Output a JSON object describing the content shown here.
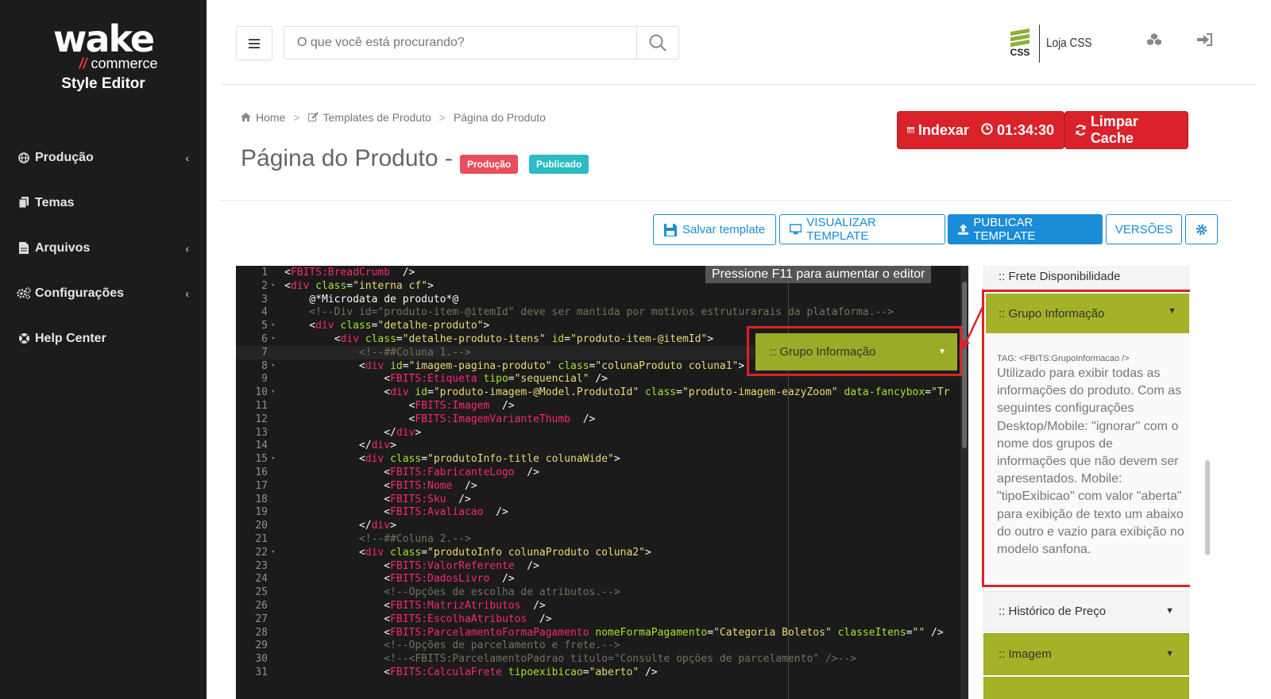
{
  "sidebar": {
    "logo_wake": "wake",
    "logo_commerce": "commerce",
    "logo_title": "Style Editor",
    "items": [
      {
        "label": "Produção",
        "icon": "globe-icon",
        "has_chevron": true
      },
      {
        "label": "Temas",
        "icon": "files-icon",
        "has_chevron": false
      },
      {
        "label": "Arquivos",
        "icon": "file-icon",
        "has_chevron": true
      },
      {
        "label": "Configurações",
        "icon": "cogs-icon",
        "has_chevron": true
      },
      {
        "label": "Help Center",
        "icon": "lifebuoy-icon",
        "has_chevron": false
      }
    ]
  },
  "topbar": {
    "search_placeholder": "O que você está procurando?",
    "brand_mark": "CSS",
    "brand_name": "Loja CSS"
  },
  "breadcrumb": {
    "home": "Home",
    "templates": "Templates de Produto",
    "current": "Página do Produto"
  },
  "page": {
    "title": "Página do Produto -",
    "badge_env": "Produção",
    "badge_status": "Publicado"
  },
  "actions": {
    "index_label": "Indexar",
    "index_timer": "01:34:30",
    "clear_cache": "Limpar Cache",
    "save_template": "Salvar template",
    "view_template": "VISUALIZAR TEMPLATE",
    "publish_template": "PUBLICAR TEMPLATE",
    "versions": "VERSÕES"
  },
  "editor": {
    "hint": "Pressione F11 para aumentar o editor",
    "active_line": 7,
    "lines": [
      {
        "n": 1,
        "fold": false
      },
      {
        "n": 2,
        "fold": true
      },
      {
        "n": 3,
        "fold": false
      },
      {
        "n": 4,
        "fold": false
      },
      {
        "n": 5,
        "fold": true
      },
      {
        "n": 6,
        "fold": true
      },
      {
        "n": 7,
        "fold": false
      },
      {
        "n": 8,
        "fold": true
      },
      {
        "n": 9,
        "fold": false
      },
      {
        "n": 10,
        "fold": true
      },
      {
        "n": 11,
        "fold": false
      },
      {
        "n": 12,
        "fold": false
      },
      {
        "n": 13,
        "fold": false
      },
      {
        "n": 14,
        "fold": false
      },
      {
        "n": 15,
        "fold": true
      },
      {
        "n": 16,
        "fold": false
      },
      {
        "n": 17,
        "fold": false
      },
      {
        "n": 18,
        "fold": false
      },
      {
        "n": 19,
        "fold": false
      },
      {
        "n": 20,
        "fold": false
      },
      {
        "n": 21,
        "fold": false
      },
      {
        "n": 22,
        "fold": true
      },
      {
        "n": 23,
        "fold": false
      },
      {
        "n": 24,
        "fold": false
      },
      {
        "n": 25,
        "fold": false
      },
      {
        "n": 26,
        "fold": false
      },
      {
        "n": 27,
        "fold": false
      },
      {
        "n": 28,
        "fold": false
      },
      {
        "n": 29,
        "fold": false
      },
      {
        "n": 30,
        "fold": false
      },
      {
        "n": 31,
        "fold": false
      }
    ],
    "code": [
      [
        [
          "t",
          "<"
        ],
        [
          "p",
          "FBITS:BreadCrumb"
        ],
        [
          "t",
          "  />"
        ]
      ],
      [
        [
          "t",
          "<"
        ],
        [
          "p",
          "div"
        ],
        [
          "t",
          " "
        ],
        [
          "a",
          "class"
        ],
        [
          "t",
          "="
        ],
        [
          "s",
          "\"interna cf\""
        ],
        [
          "t",
          ">"
        ]
      ],
      [
        [
          "t",
          "    @*Microdata de produto*@"
        ]
      ],
      [
        [
          "c",
          "    <!--Div id=\"produto-item-@itemId\" deve ser mantida por motivos estruturarais da plataforma.-->"
        ]
      ],
      [
        [
          "t",
          "    <"
        ],
        [
          "p",
          "div"
        ],
        [
          "t",
          " "
        ],
        [
          "a",
          "class"
        ],
        [
          "t",
          "="
        ],
        [
          "s",
          "\"detalhe-produto\""
        ],
        [
          "t",
          ">"
        ]
      ],
      [
        [
          "t",
          "        <"
        ],
        [
          "p",
          "div"
        ],
        [
          "t",
          " "
        ],
        [
          "a",
          "class"
        ],
        [
          "t",
          "="
        ],
        [
          "s",
          "\"detalhe-produto-itens\""
        ],
        [
          "t",
          " "
        ],
        [
          "a",
          "id"
        ],
        [
          "t",
          "="
        ],
        [
          "s",
          "\"produto-item-@itemId\""
        ],
        [
          "t",
          ">"
        ]
      ],
      [
        [
          "c",
          "            <!--##Coluna 1.-->"
        ]
      ],
      [
        [
          "t",
          "            <"
        ],
        [
          "p",
          "div"
        ],
        [
          "t",
          " "
        ],
        [
          "a",
          "id"
        ],
        [
          "t",
          "="
        ],
        [
          "s",
          "\"imagem-pagina-produto\""
        ],
        [
          "t",
          " "
        ],
        [
          "a",
          "class"
        ],
        [
          "t",
          "="
        ],
        [
          "s",
          "\"colunaProduto coluna1\""
        ],
        [
          "t",
          ">"
        ]
      ],
      [
        [
          "t",
          "                <"
        ],
        [
          "p",
          "FBITS:Etiqueta"
        ],
        [
          "t",
          " "
        ],
        [
          "a",
          "tipo"
        ],
        [
          "t",
          "="
        ],
        [
          "s",
          "\"sequencial\""
        ],
        [
          "t",
          " />"
        ]
      ],
      [
        [
          "t",
          "                <"
        ],
        [
          "p",
          "div"
        ],
        [
          "t",
          " "
        ],
        [
          "a",
          "id"
        ],
        [
          "t",
          "="
        ],
        [
          "s",
          "\"produto-imagem-@Model.ProdutoId\""
        ],
        [
          "t",
          " "
        ],
        [
          "a",
          "class"
        ],
        [
          "t",
          "="
        ],
        [
          "s",
          "\"produto-imagem-eazyZoom\""
        ],
        [
          "t",
          " "
        ],
        [
          "a",
          "data-fancybox"
        ],
        [
          "t",
          "="
        ],
        [
          "s",
          "\"Tr"
        ]
      ],
      [
        [
          "t",
          "                    <"
        ],
        [
          "p",
          "FBITS:Imagem"
        ],
        [
          "t",
          "  />"
        ]
      ],
      [
        [
          "t",
          "                    <"
        ],
        [
          "p",
          "FBITS:ImagemVarianteThumb"
        ],
        [
          "t",
          "  />"
        ]
      ],
      [
        [
          "t",
          "                </"
        ],
        [
          "p",
          "div"
        ],
        [
          "t",
          ">"
        ]
      ],
      [
        [
          "t",
          "            </"
        ],
        [
          "p",
          "div"
        ],
        [
          "t",
          ">"
        ]
      ],
      [
        [
          "t",
          "            <"
        ],
        [
          "p",
          "div"
        ],
        [
          "t",
          " "
        ],
        [
          "a",
          "class"
        ],
        [
          "t",
          "="
        ],
        [
          "s",
          "\"produtoInfo-title colunaWide\""
        ],
        [
          "t",
          ">"
        ]
      ],
      [
        [
          "t",
          "                <"
        ],
        [
          "p",
          "FBITS:FabricanteLogo"
        ],
        [
          "t",
          "  />"
        ]
      ],
      [
        [
          "t",
          "                <"
        ],
        [
          "p",
          "FBITS:Nome"
        ],
        [
          "t",
          "  />"
        ]
      ],
      [
        [
          "t",
          "                <"
        ],
        [
          "p",
          "FBITS:Sku"
        ],
        [
          "t",
          "  />"
        ]
      ],
      [
        [
          "t",
          "                <"
        ],
        [
          "p",
          "FBITS:Avaliacao"
        ],
        [
          "t",
          "  />"
        ]
      ],
      [
        [
          "t",
          "            </"
        ],
        [
          "p",
          "div"
        ],
        [
          "t",
          ">"
        ]
      ],
      [
        [
          "c",
          "            <!--##Coluna 2.-->"
        ]
      ],
      [
        [
          "t",
          "            <"
        ],
        [
          "p",
          "div"
        ],
        [
          "t",
          " "
        ],
        [
          "a",
          "class"
        ],
        [
          "t",
          "="
        ],
        [
          "s",
          "\"produtoInfo colunaProduto coluna2\""
        ],
        [
          "t",
          ">"
        ]
      ],
      [
        [
          "t",
          "                <"
        ],
        [
          "p",
          "FBITS:ValorReferente"
        ],
        [
          "t",
          "  />"
        ]
      ],
      [
        [
          "t",
          "                <"
        ],
        [
          "p",
          "FBITS:DadosLivro"
        ],
        [
          "t",
          "  />"
        ]
      ],
      [
        [
          "c",
          "                <!--Opções de escolha de atributos.-->"
        ]
      ],
      [
        [
          "t",
          "                <"
        ],
        [
          "p",
          "FBITS:MatrizAtributos"
        ],
        [
          "t",
          "  />"
        ]
      ],
      [
        [
          "t",
          "                <"
        ],
        [
          "p",
          "FBITS:EscolhaAtributos"
        ],
        [
          "t",
          "  />"
        ]
      ],
      [
        [
          "t",
          "                <"
        ],
        [
          "p",
          "FBITS:ParcelamentoFormaPagamento"
        ],
        [
          "t",
          " "
        ],
        [
          "a",
          "nomeFormaPagamento"
        ],
        [
          "t",
          "="
        ],
        [
          "s",
          "\"Categoria Boletos\""
        ],
        [
          "t",
          " "
        ],
        [
          "a",
          "classeItens"
        ],
        [
          "t",
          "="
        ],
        [
          "s",
          "\"\""
        ],
        [
          "t",
          " />"
        ]
      ],
      [
        [
          "c",
          "                <!--Opções de parcelamento e frete.-->"
        ]
      ],
      [
        [
          "c",
          "                <!--<FBITS:ParcelamentoPadrao titulo=\"Consulte opções de parcelamento\" />-->"
        ]
      ],
      [
        [
          "t",
          "                <"
        ],
        [
          "p",
          "FBITS:CalculaFrete"
        ],
        [
          "t",
          " "
        ],
        [
          "a",
          "tipoexibicao"
        ],
        [
          "t",
          "="
        ],
        [
          "s",
          "\"aberto\""
        ],
        [
          "t",
          " />"
        ]
      ]
    ]
  },
  "callout": {
    "label": ":: Grupo Informação"
  },
  "right_panel": {
    "top_item": ":: Frete Disponibilidade",
    "group_title": ":: Grupo Informação",
    "group_tag": "TAG: <FBITS:GrupoInformacao />",
    "group_desc": "Utilizado para exibir todas as informações do produto. Com as seguintes configurações Desktop/Mobile: \"ignorar\" com o nome dos grupos de informações que não devem ser apresentados. Mobile: \"tipoExibicao\" com valor \"aberta\" para exibição de texto um abaixo do outro e vazio para exibição no modelo sanfona.",
    "item_historico": ":: Histórico de Preço",
    "item_imagem": ":: Imagem"
  },
  "colors": {
    "accent_red": "#d9222a",
    "accent_blue": "#1a8cd8",
    "olive": "#a3b227"
  }
}
